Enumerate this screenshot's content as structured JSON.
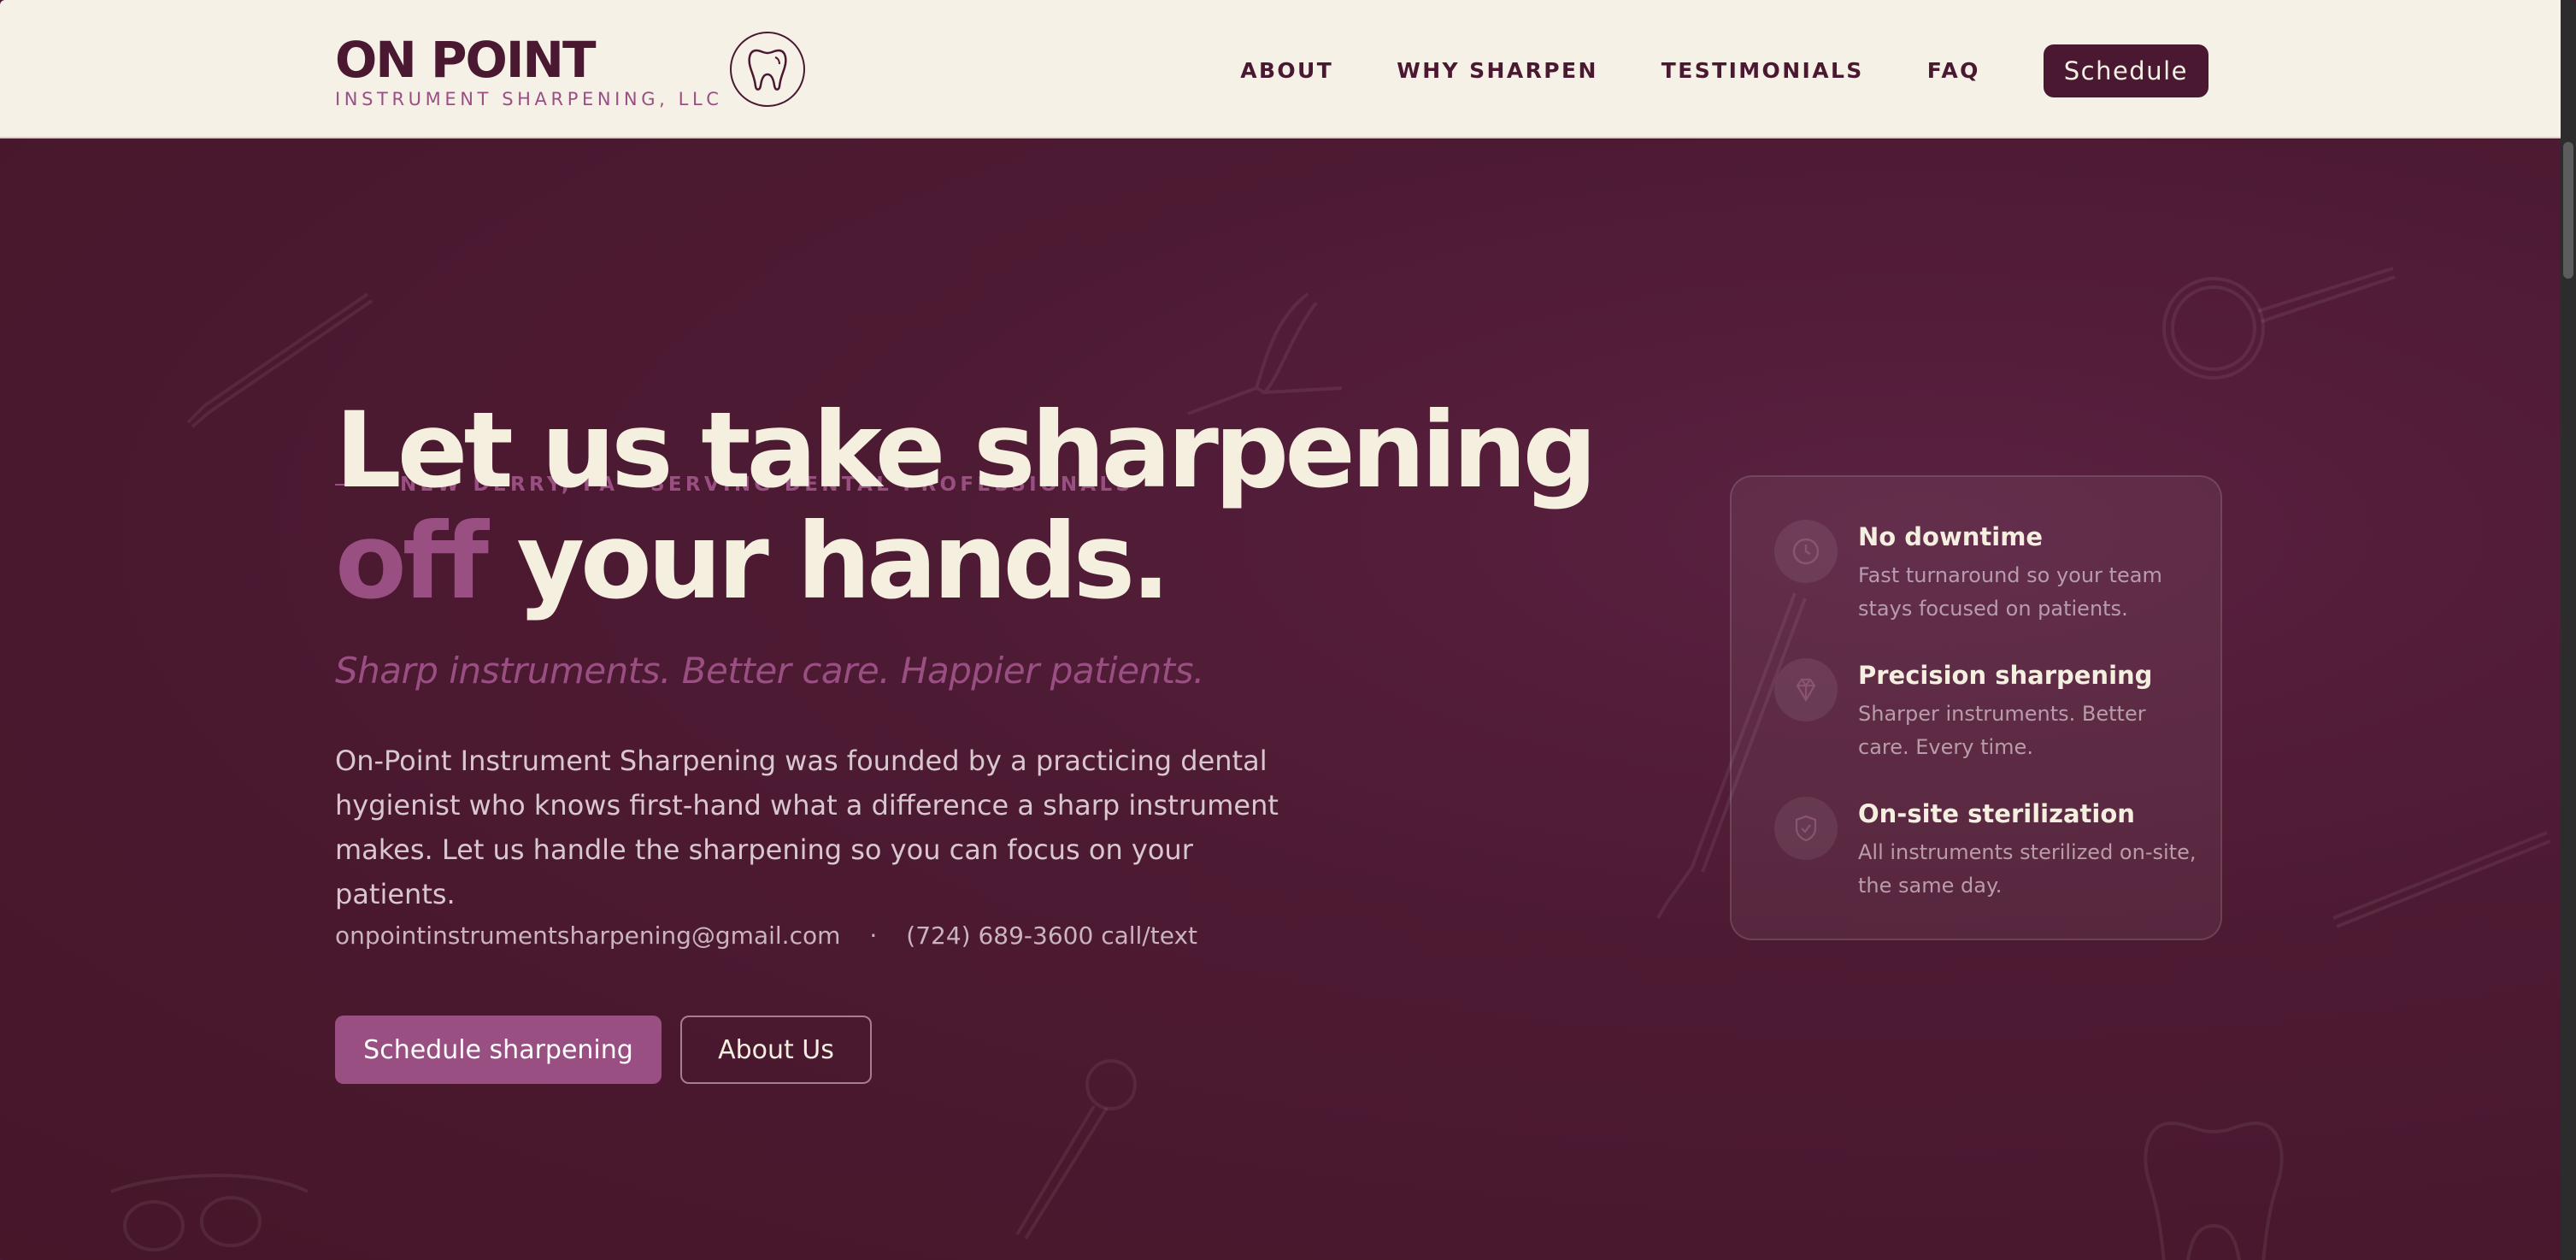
{
  "header": {
    "brand_name": "ON POINT",
    "brand_sub": "INSTRUMENT SHARPENING, LLC",
    "nav": [
      "ABOUT",
      "WHY SHARPEN",
      "TESTIMONIALS",
      "FAQ"
    ],
    "cta_label": "Schedule"
  },
  "hero": {
    "eyebrow": "NEW DERRY, PA · SERVING DENTAL PROFESSIONALS",
    "headline_line1": "Let us take sharpening",
    "headline_accent": "off",
    "headline_rest": " your hands.",
    "tagline": "Sharp instruments. Better care. Happier patients.",
    "description": "On-Point Instrument Sharpening was founded by a practicing dental hygienist who knows first-hand what a difference a sharp instrument makes. Let us handle the sharpening so you can focus on your patients.",
    "email": "onpointinstrumentsharpening@gmail.com",
    "separator": "·",
    "phone": "(724) 689-3600 call/text",
    "primary_button": "Schedule sharpening",
    "secondary_button": "About Us"
  },
  "features": [
    {
      "icon": "clock-icon",
      "title": "No downtime",
      "desc": "Fast turnaround so your team stays focused on patients."
    },
    {
      "icon": "diamond-icon",
      "title": "Precision sharpening",
      "desc": "Sharper instruments. Better care. Every time."
    },
    {
      "icon": "shield-check-icon",
      "title": "On-site sterilization",
      "desc": "All instruments sterilized on-site, the same day."
    }
  ],
  "colors": {
    "brand": "#4a1830",
    "accent": "#9a4f83",
    "cream": "#f5f1e6"
  }
}
